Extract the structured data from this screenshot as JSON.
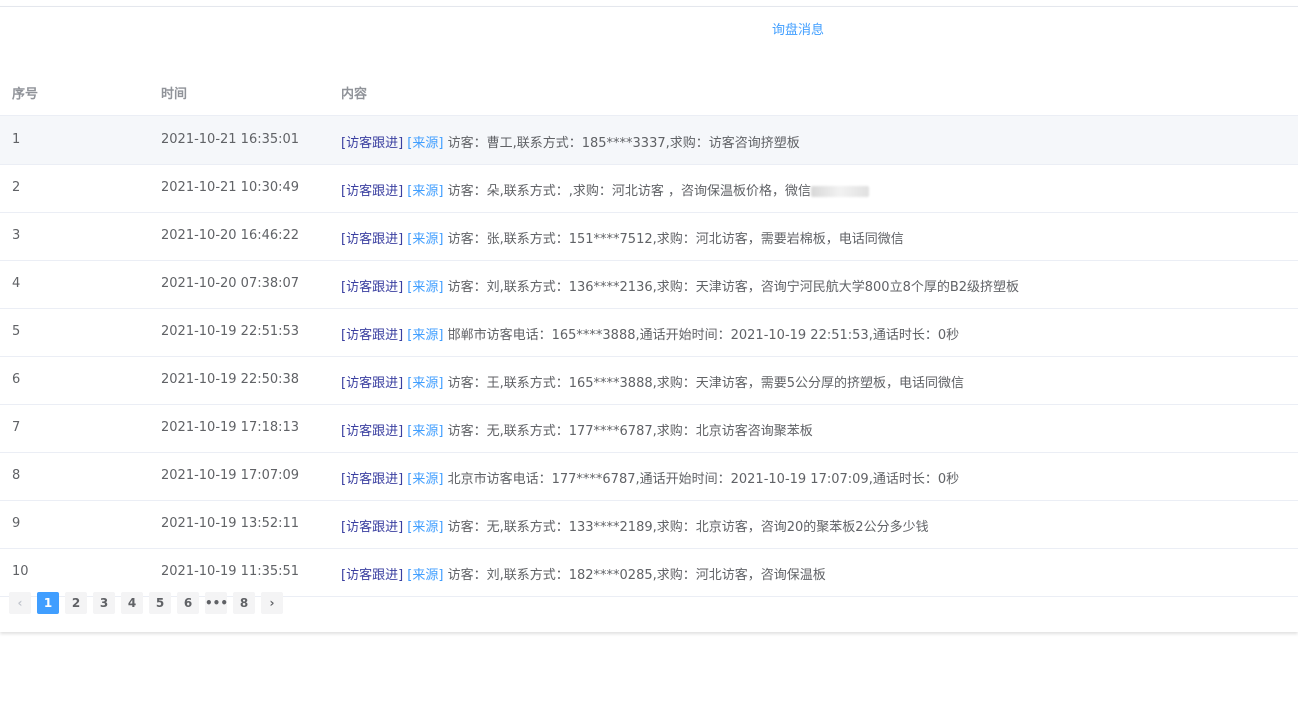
{
  "tab": {
    "label": "询盘消息"
  },
  "table": {
    "headers": {
      "index": "序号",
      "time": "时间",
      "content": "内容"
    },
    "link_follow": "[访客跟进]",
    "link_source": "[来源]",
    "rows": [
      {
        "index": "1",
        "time": "2021-10-21 16:35:01",
        "text": "访客：曹工,联系方式：185****3337,求购：访客咨询挤塑板"
      },
      {
        "index": "2",
        "time": "2021-10-21 10:30:49",
        "text": "访客：朵,联系方式：,求购：河北访客 ，咨询保温板价格，微信",
        "text_tail": ""
      },
      {
        "index": "3",
        "time": "2021-10-20 16:46:22",
        "text": "访客：张,联系方式：151****7512,求购：河北访客，需要岩棉板，电话同微信"
      },
      {
        "index": "4",
        "time": "2021-10-20 07:38:07",
        "text": "访客：刘,联系方式：136****2136,求购：天津访客，咨询宁河民航大学800立8个厚的B2级挤塑板"
      },
      {
        "index": "5",
        "time": "2021-10-19 22:51:53",
        "text": "邯郸市访客电话：165****3888,通话开始时间：2021-10-19 22:51:53,通话时长：0秒"
      },
      {
        "index": "6",
        "time": "2021-10-19 22:50:38",
        "text": "访客：王,联系方式：165****3888,求购：天津访客，需要5公分厚的挤塑板，电话同微信"
      },
      {
        "index": "7",
        "time": "2021-10-19 17:18:13",
        "text": "访客：无,联系方式：177****6787,求购：北京访客咨询聚苯板"
      },
      {
        "index": "8",
        "time": "2021-10-19 17:07:09",
        "text": "北京市访客电话：177****6787,通话开始时间：2021-10-19 17:07:09,通话时长：0秒"
      },
      {
        "index": "9",
        "time": "2021-10-19 13:52:11",
        "text": "访客：无,联系方式：133****2189,求购：北京访客，咨询20的聚苯板2公分多少钱"
      },
      {
        "index": "10",
        "time": "2021-10-19 11:35:51",
        "text": "访客：刘,联系方式：182****0285,求购：河北访客，咨询保温板"
      }
    ]
  },
  "pagination": {
    "prev": "‹",
    "pages": [
      "1",
      "2",
      "3",
      "4",
      "5",
      "6"
    ],
    "ellipsis": "•••",
    "last": "8",
    "next": "›",
    "current": "1"
  },
  "colors": {
    "accent": "#409eff",
    "follow_link": "#3a3fa0"
  }
}
